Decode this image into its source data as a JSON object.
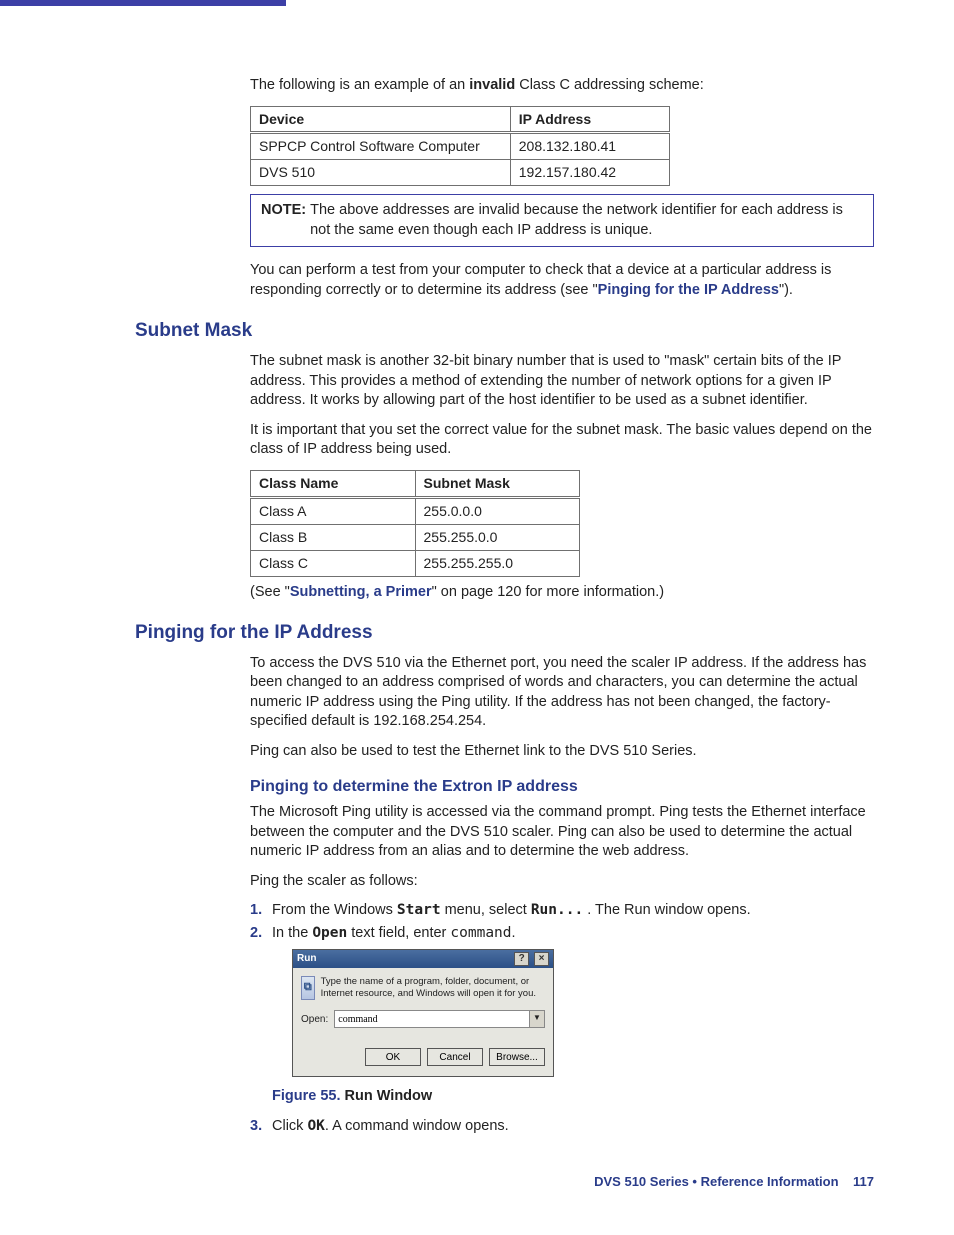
{
  "intro": {
    "line1_a": "The following is an example of an ",
    "line1_b": "invalid",
    "line1_c": " Class C addressing scheme:"
  },
  "table1": {
    "h1": "Device",
    "h2": "IP Address",
    "r1c1": "SPPCP Control Software Computer",
    "r1c2": "208.132.180.41",
    "r2c1": "DVS 510",
    "r2c2": "192.157.180.42"
  },
  "note": {
    "label": "NOTE:",
    "text": "The above addresses are invalid because the network identifier for each address is not the same even though each IP address is unique."
  },
  "para_test_a": "You can perform a test from your computer to check that a device at a particular address is responding correctly or to determine its address (see \"",
  "para_test_link": "Pinging for the IP Address",
  "para_test_b": "\").",
  "subnet": {
    "heading": "Subnet Mask",
    "p1": "The subnet mask is another 32-bit binary number that is used to \"mask\" certain bits of the IP address. This provides a method of extending the number of network options for a given IP address. It works by allowing part of the host identifier to be used as a subnet identifier.",
    "p2": "It is important that you set the correct value for the subnet mask. The basic values depend on the class of IP address being used."
  },
  "table2": {
    "h1": "Class Name",
    "h2": "Subnet Mask",
    "r1c1": "Class A",
    "r1c2": "255.0.0.0",
    "r2c1": "Class B",
    "r2c2": "255.255.0.0",
    "r3c1": "Class C",
    "r3c2": "255.255.255.0"
  },
  "subnet_see_a": "(See \"",
  "subnet_see_link": "Subnetting, a Primer",
  "subnet_see_b": "\" on page 120 for more information.)",
  "ping": {
    "heading": "Pinging for the IP Address",
    "p1": "To access the DVS 510 via the Ethernet port, you need the scaler IP address. If the address has been changed to an address comprised of words and characters, you can determine the actual numeric IP address using the Ping utility. If the address has not been changed, the factory-specified default is 192.168.254.254.",
    "p2": "Ping can also be used to test the Ethernet link to the DVS 510 Series.",
    "sub": "Pinging to determine the Extron IP address",
    "p3": "The Microsoft Ping utility is accessed via the command prompt. Ping tests the Ethernet interface between the computer and the DVS 510 scaler. Ping can also be used to determine the actual numeric IP address from an alias and to determine the web address.",
    "p4": "Ping the scaler as follows:"
  },
  "steps": {
    "s1_num": "1.",
    "s1_a": "From the Windows ",
    "s1_b": "Start",
    "s1_c": " menu, select ",
    "s1_d": "Run...",
    "s1_e": " . The Run window opens.",
    "s2_num": "2.",
    "s2_a": "In the ",
    "s2_b": "Open",
    "s2_c": " text field, enter ",
    "s2_d": "command",
    "s2_e": ".",
    "s3_num": "3.",
    "s3_a": "Click ",
    "s3_b": "OK",
    "s3_c": ". A command window opens."
  },
  "run_dialog": {
    "title": "Run",
    "help": "?",
    "close": "×",
    "msg": "Type the name of a program, folder, document, or Internet resource, and Windows will open it for you.",
    "open_label": "Open:",
    "open_value": "command",
    "arrow": "▼",
    "ok": "OK",
    "cancel": "Cancel",
    "browse": "Browse..."
  },
  "figure": {
    "num": "Figure 55.",
    "cap": "  Run Window"
  },
  "footer": {
    "text": "DVS 510 Series • Reference Information",
    "page": "117"
  }
}
